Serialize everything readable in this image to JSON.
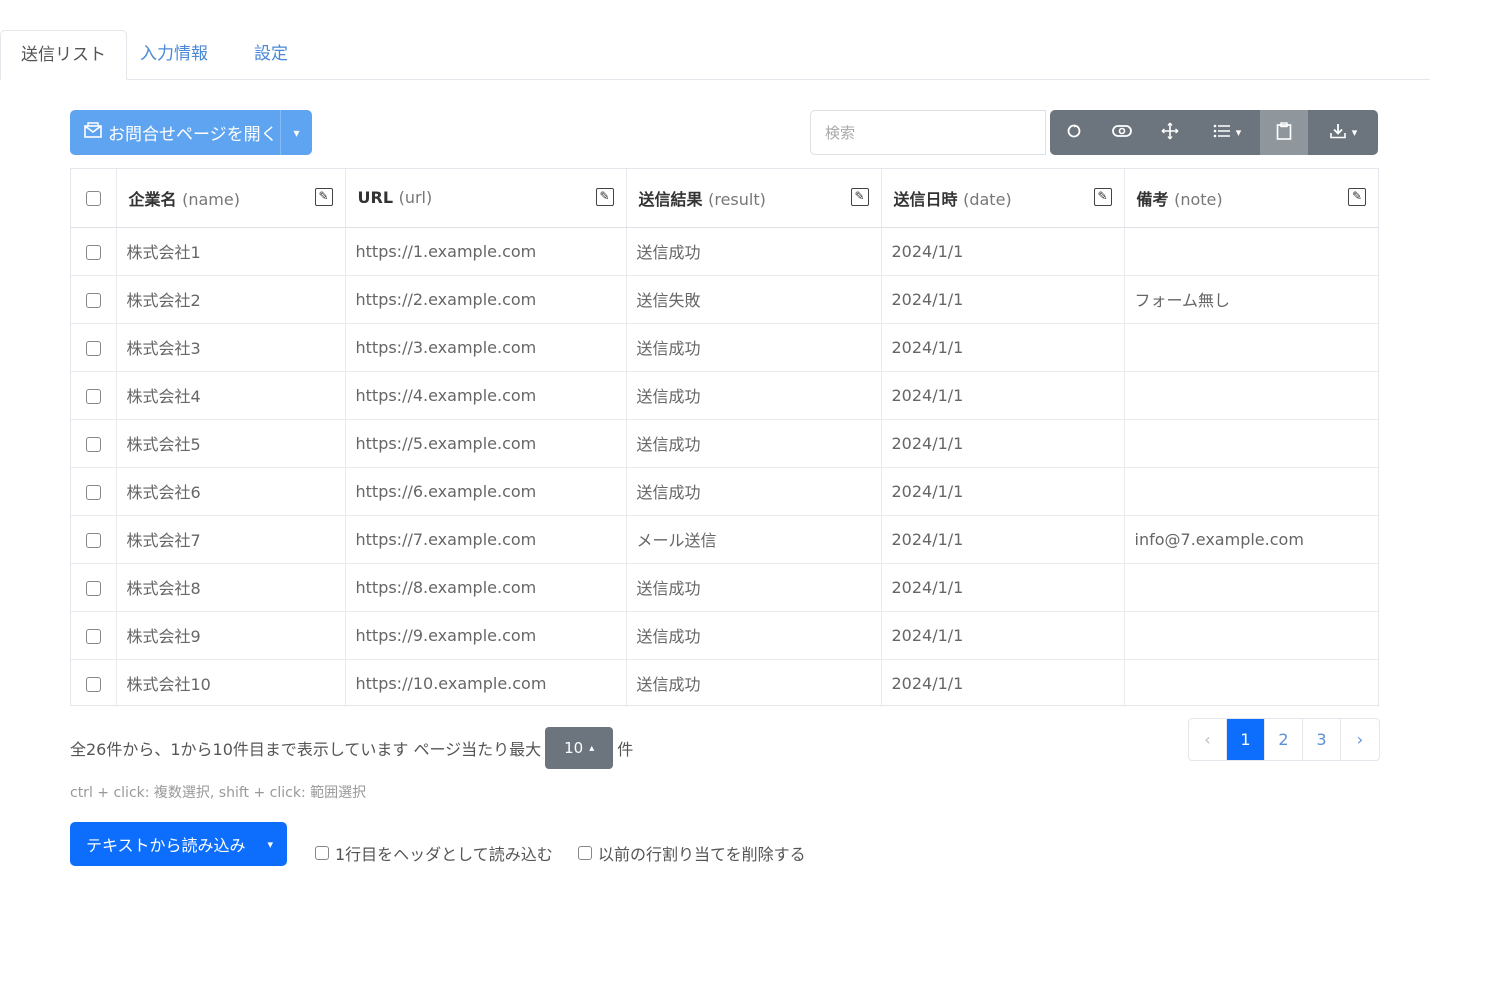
{
  "tabs": [
    {
      "label": "送信リスト",
      "active": true
    },
    {
      "label": "入力情報",
      "active": false
    },
    {
      "label": "設定",
      "active": false
    }
  ],
  "toolbar": {
    "open_label": "お問合せページを開く",
    "search_placeholder": "検索",
    "tool_icons": [
      "refresh-icon",
      "toggle-view-icon",
      "fullscreen-icon",
      "columns-icon",
      "clipboard-icon",
      "export-icon"
    ]
  },
  "table": {
    "columns": [
      {
        "label": "企業名",
        "key": "(name)"
      },
      {
        "label": "URL",
        "key": "(url)"
      },
      {
        "label": "送信結果",
        "key": "(result)"
      },
      {
        "label": "送信日時",
        "key": "(date)"
      },
      {
        "label": "備考",
        "key": "(note)"
      }
    ],
    "rows": [
      {
        "name": "株式会社1",
        "url": "https://1.example.com",
        "result": "送信成功",
        "date": "2024/1/1",
        "note": ""
      },
      {
        "name": "株式会社2",
        "url": "https://2.example.com",
        "result": "送信失敗",
        "date": "2024/1/1",
        "note": "フォーム無し"
      },
      {
        "name": "株式会社3",
        "url": "https://3.example.com",
        "result": "送信成功",
        "date": "2024/1/1",
        "note": ""
      },
      {
        "name": "株式会社4",
        "url": "https://4.example.com",
        "result": "送信成功",
        "date": "2024/1/1",
        "note": ""
      },
      {
        "name": "株式会社5",
        "url": "https://5.example.com",
        "result": "送信成功",
        "date": "2024/1/1",
        "note": ""
      },
      {
        "name": "株式会社6",
        "url": "https://6.example.com",
        "result": "送信成功",
        "date": "2024/1/1",
        "note": ""
      },
      {
        "name": "株式会社7",
        "url": "https://7.example.com",
        "result": "メール送信",
        "date": "2024/1/1",
        "note": "info@7.example.com"
      },
      {
        "name": "株式会社8",
        "url": "https://8.example.com",
        "result": "送信成功",
        "date": "2024/1/1",
        "note": ""
      },
      {
        "name": "株式会社9",
        "url": "https://9.example.com",
        "result": "送信成功",
        "date": "2024/1/1",
        "note": ""
      },
      {
        "name": "株式会社10",
        "url": "https://10.example.com",
        "result": "送信成功",
        "date": "2024/1/1",
        "note": ""
      }
    ]
  },
  "footer": {
    "info_prefix": "全26件から、1から10件目まで表示しています ページ当たり最大",
    "page_size": "10",
    "info_suffix": "件",
    "pages": [
      "‹",
      "1",
      "2",
      "3",
      "›"
    ],
    "current_page": "1",
    "hint": "ctrl + click: 複数選択, shift + click: 範囲選択",
    "import_label": "テキストから読み込み",
    "option_header": "1行目をヘッダとして読み込む",
    "option_clear": "以前の行割り当てを削除する"
  },
  "colors": {
    "primary": "#0d6efd",
    "primary_light": "#5fa4f0",
    "secondary": "#6c757d"
  }
}
